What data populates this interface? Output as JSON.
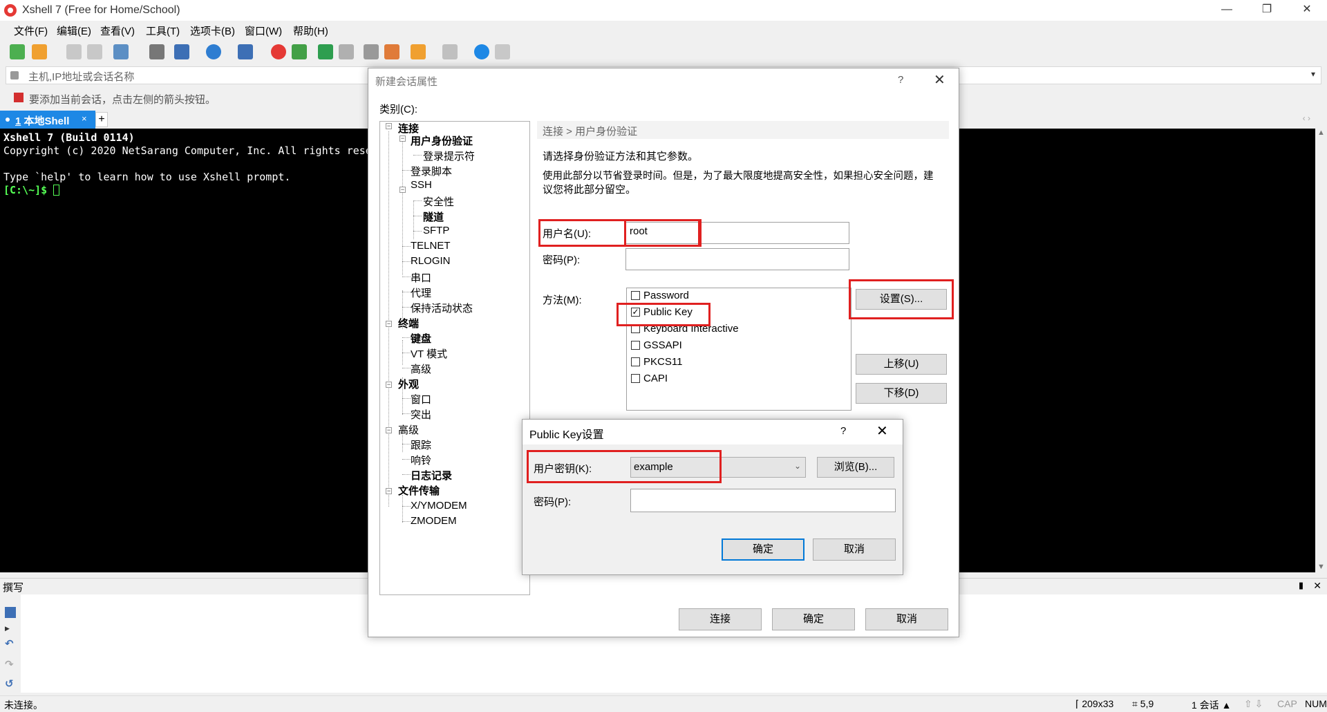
{
  "window": {
    "title": "Xshell 7 (Free for Home/School)",
    "controls": [
      "—",
      "❐",
      "✕"
    ]
  },
  "menu": [
    "文件(F)",
    "编辑(E)",
    "查看(V)",
    "工具(T)",
    "选项卡(B)",
    "窗口(W)",
    "帮助(H)"
  ],
  "address": {
    "placeholder": "主机,IP地址或会话名称",
    "dropdown": "▾"
  },
  "hint": "要添加当前会话，点击左侧的箭头按钮。",
  "tabs": {
    "active": {
      "number": "1",
      "label": "本地Shell",
      "close": "×"
    },
    "add": "+",
    "nav": "‹ ›"
  },
  "terminal": {
    "line1": "Xshell 7 (Build 0114)",
    "line2": "Copyright (c) 2020 NetSarang Computer, Inc. All rights rese",
    "line3": "Type `help' to learn how to use Xshell prompt.",
    "prompt": "[C:\\~]$ "
  },
  "compose": {
    "title": "撰写",
    "pin": "📌",
    "close": "✕"
  },
  "status": {
    "left": "未连接。",
    "size": "209x33",
    "pos": "5,9",
    "sessions": "1 会话",
    "cap": "CAP",
    "num": "NUM"
  },
  "dialog": {
    "title": "新建会话属性",
    "help": "?",
    "close": "✕",
    "category_label": "类别(C):",
    "tree": [
      {
        "label": "连接",
        "bold": true
      },
      {
        "label": "用户身份验证",
        "bold": true
      },
      {
        "label": "登录提示符",
        "bold": false
      },
      {
        "label": "登录脚本",
        "bold": false
      },
      {
        "label": "SSH",
        "bold": false
      },
      {
        "label": "安全性",
        "bold": false
      },
      {
        "label": "隧道",
        "bold": true
      },
      {
        "label": "SFTP",
        "bold": false
      },
      {
        "label": "TELNET",
        "bold": false
      },
      {
        "label": "RLOGIN",
        "bold": false
      },
      {
        "label": "串口",
        "bold": false
      },
      {
        "label": "代理",
        "bold": false
      },
      {
        "label": "保持活动状态",
        "bold": false
      },
      {
        "label": "终端",
        "bold": true
      },
      {
        "label": "键盘",
        "bold": true
      },
      {
        "label": "VT 模式",
        "bold": false
      },
      {
        "label": "高级",
        "bold": false
      },
      {
        "label": "外观",
        "bold": true
      },
      {
        "label": "窗口",
        "bold": false
      },
      {
        "label": "突出",
        "bold": false
      },
      {
        "label": "高级",
        "bold": false
      },
      {
        "label": "跟踪",
        "bold": false
      },
      {
        "label": "响铃",
        "bold": false
      },
      {
        "label": "日志记录",
        "bold": true
      },
      {
        "label": "文件传输",
        "bold": true
      },
      {
        "label": "X/YMODEM",
        "bold": false
      },
      {
        "label": "ZMODEM",
        "bold": false
      }
    ],
    "breadcrumb": "连接 > 用户身份验证",
    "intro1": "请选择身份验证方法和其它参数。",
    "intro2a": "使用此部分以节省登录时间。但是，为了最大限度地提高安全性，如果担心安全问题，建",
    "intro2b": "议您将此部分留空。",
    "username_label": "用户名(U):",
    "username_value": "root",
    "password_label": "密码(P):",
    "password_value": "",
    "method_label": "方法(M):",
    "methods": [
      {
        "label": "Password",
        "checked": false
      },
      {
        "label": "Public Key",
        "checked": true
      },
      {
        "label": "Keyboard Interactive",
        "checked": false
      },
      {
        "label": "GSSAPI",
        "checked": false
      },
      {
        "label": "PKCS11",
        "checked": false
      },
      {
        "label": "CAPI",
        "checked": false
      }
    ],
    "settings_button": "设置(S)...",
    "move_up_button": "上移(U)",
    "move_down_button": "下移(D)",
    "connect_button": "连接",
    "ok_button": "确定",
    "cancel_button": "取消"
  },
  "pubkey_dialog": {
    "title": "Public Key设置",
    "help": "?",
    "close": "✕",
    "key_label": "用户密钥(K):",
    "key_value": "example",
    "browse_button": "浏览(B)...",
    "passphrase_label": "密码(P):",
    "passphrase_value": "",
    "ok_button": "确定",
    "cancel_button": "取消"
  },
  "colors": {
    "tab_active": "#1e88e5",
    "highlight_box": "#e02020",
    "prompt": "#55ff55",
    "default_button_border": "#0078d7"
  }
}
